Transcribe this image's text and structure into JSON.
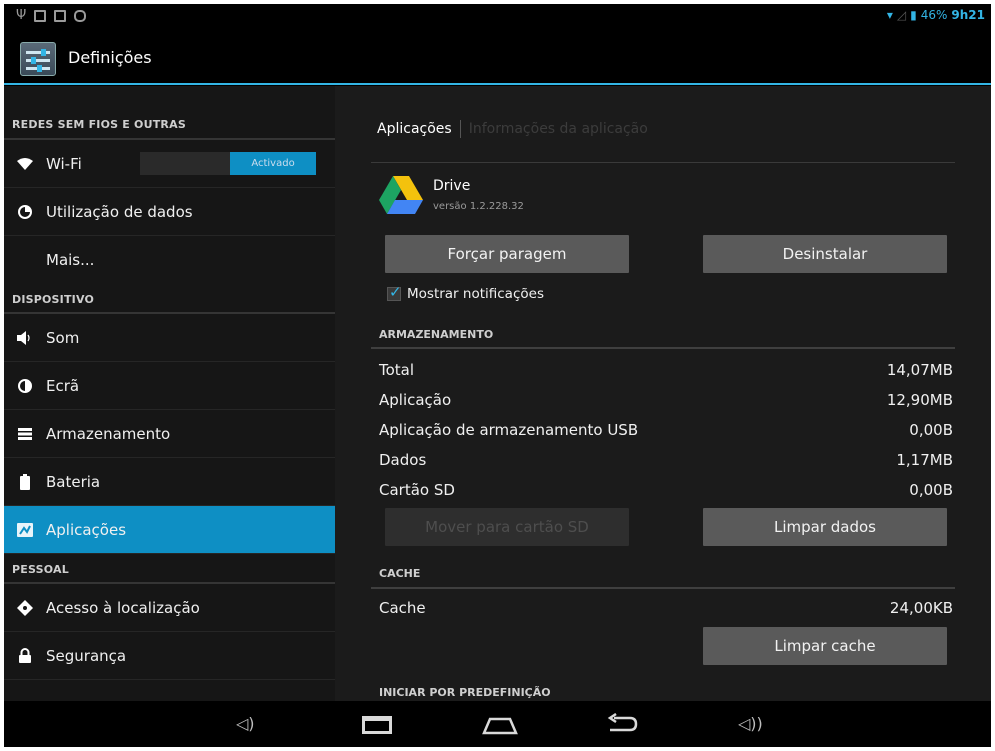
{
  "status_bar": {
    "battery_percent": "46%",
    "time": "9h21"
  },
  "action_bar": {
    "title": "Definições"
  },
  "left_panel": {
    "sections": [
      {
        "header": "REDES SEM FIOS E OUTRAS",
        "items": [
          {
            "label": "Wi-Fi",
            "icon": "wifi-icon",
            "toggle_label": "Activado"
          },
          {
            "label": "Utilização de dados",
            "icon": "data-usage-icon"
          },
          {
            "label": "Mais...",
            "icon": ""
          }
        ]
      },
      {
        "header": "DISPOSITIVO",
        "items": [
          {
            "label": "Som",
            "icon": "speaker-icon"
          },
          {
            "label": "Ecrã",
            "icon": "brightness-icon"
          },
          {
            "label": "Armazenamento",
            "icon": "storage-icon"
          },
          {
            "label": "Bateria",
            "icon": "battery-icon"
          },
          {
            "label": "Aplicações",
            "icon": "apps-icon",
            "selected": true
          }
        ]
      },
      {
        "header": "PESSOAL",
        "items": [
          {
            "label": "Acesso à localização",
            "icon": "location-icon"
          },
          {
            "label": "Segurança",
            "icon": "lock-icon"
          }
        ]
      }
    ]
  },
  "right_panel": {
    "breadcrumb": {
      "current": "Aplicações",
      "next": "Informações da aplicação"
    },
    "app": {
      "name": "Drive",
      "version": "versão 1.2.228.32"
    },
    "buttons": {
      "force_stop": "Forçar paragem",
      "uninstall": "Desinstalar",
      "move_to_sd": "Mover para cartão SD",
      "clear_data": "Limpar dados",
      "clear_cache": "Limpar cache"
    },
    "show_notifications": {
      "label": "Mostrar notificações",
      "checked": true
    },
    "storage": {
      "header": "ARMAZENAMENTO",
      "rows": [
        {
          "label": "Total",
          "value": "14,07MB"
        },
        {
          "label": "Aplicação",
          "value": "12,90MB"
        },
        {
          "label": "Aplicação de armazenamento USB",
          "value": "0,00B"
        },
        {
          "label": "Dados",
          "value": "1,17MB"
        },
        {
          "label": "Cartão SD",
          "value": "0,00B"
        }
      ]
    },
    "cache": {
      "header": "CACHE",
      "label": "Cache",
      "value": "24,00KB"
    },
    "launch_default": {
      "header": "INICIAR POR PREDEFINIÇÃO"
    }
  },
  "colors": {
    "accent": "#33b5e5",
    "selected": "#0e8fc4",
    "button": "#5a5a5a"
  }
}
